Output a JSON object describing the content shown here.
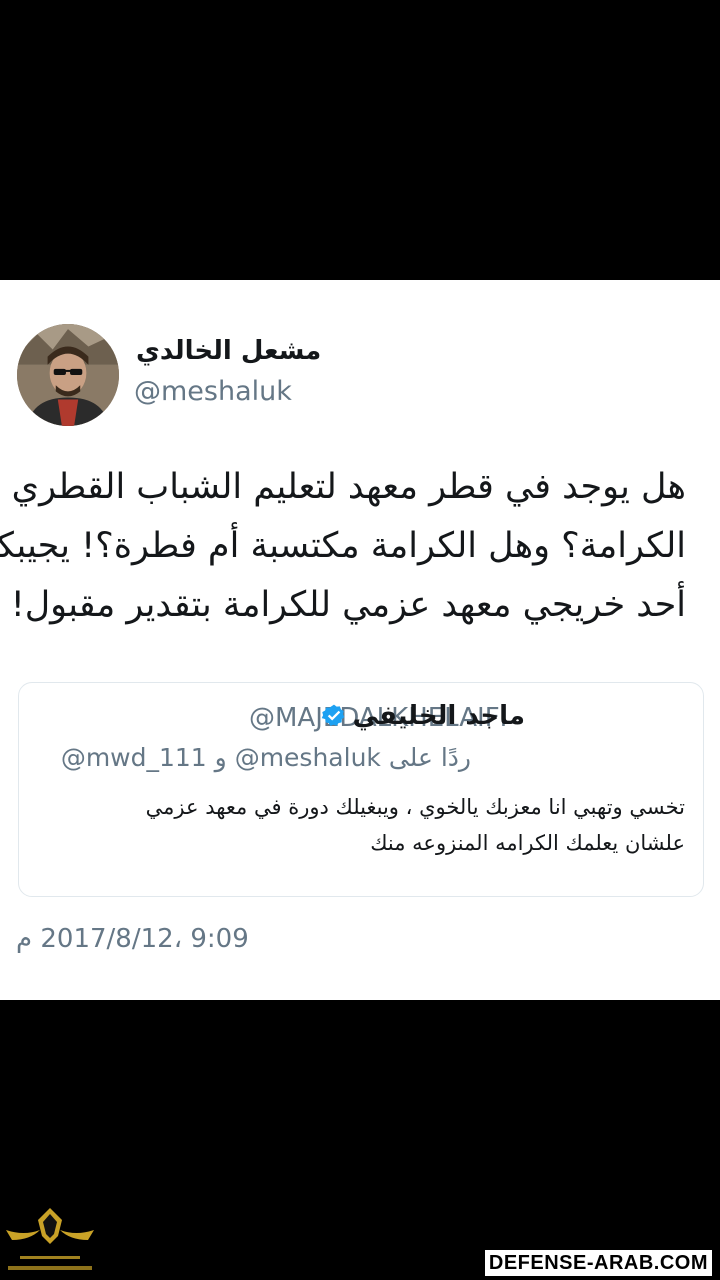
{
  "tweet": {
    "display_name": "مشعل الخالدي",
    "handle": "@meshaluk",
    "text_lines": [
      "هل يوجد في قطر معهد لتعليم الشباب القطري",
      "الكرامة؟ وهل الكرامة مكتسبة أم فطرة؟! يجيبكم",
      "أحد خريجي معهد عزمي للكرامة بتقدير مقبول!"
    ],
    "timestamp": "9:09 ،2017/8/12 م"
  },
  "quoted_tweet": {
    "display_name": "ماجد الخليفي",
    "handle": "@MAJEDALKHELAIFI",
    "reply_prefix": "ردًا على",
    "reply_to_1": "@meshaluk",
    "reply_connector": "و",
    "reply_to_2": "@mwd_111",
    "text_lines": [
      "تخسي وتهبي انا معزبك يالخوي ، ويبغيلك دورة في معهد عزمي",
      "علشان يعلمك الكرامه المنزوعه منك"
    ]
  },
  "icons": {
    "avatar": "user-avatar",
    "verified": "verified-badge-icon",
    "logo": "site-logo"
  },
  "colors": {
    "verified": "#1da1f2",
    "secondary_text": "#657786",
    "primary_text": "#14171a"
  },
  "watermark": {
    "label": "DEFENSE-ARAB.COM"
  }
}
